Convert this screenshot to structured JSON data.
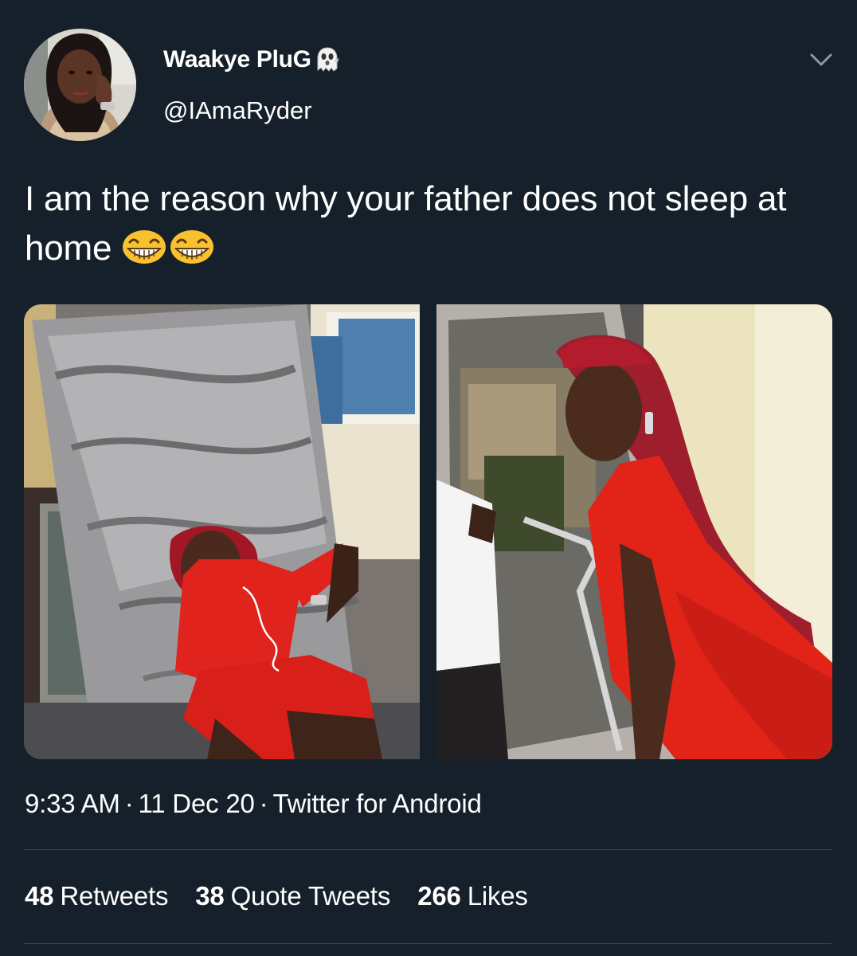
{
  "tweet": {
    "display_name": "Waakye PluG",
    "name_emoji_icon": "ghost-icon",
    "handle": "@IAmaRyder",
    "text": "I am the reason why your father does not sleep at home",
    "text_emojis": [
      "grinning-face-icon",
      "grinning-face-icon"
    ],
    "time": "9:33 AM",
    "date": "11 Dec 20",
    "source": "Twitter for Android",
    "separator": "·"
  },
  "stats": {
    "retweets_count": "48",
    "retweets_label": "Retweets",
    "quotes_count": "38",
    "quotes_label": "Quote Tweets",
    "likes_count": "266",
    "likes_label": "Likes"
  },
  "colors": {
    "background": "#15202b",
    "text": "#ffffff",
    "divider": "#38444d"
  }
}
